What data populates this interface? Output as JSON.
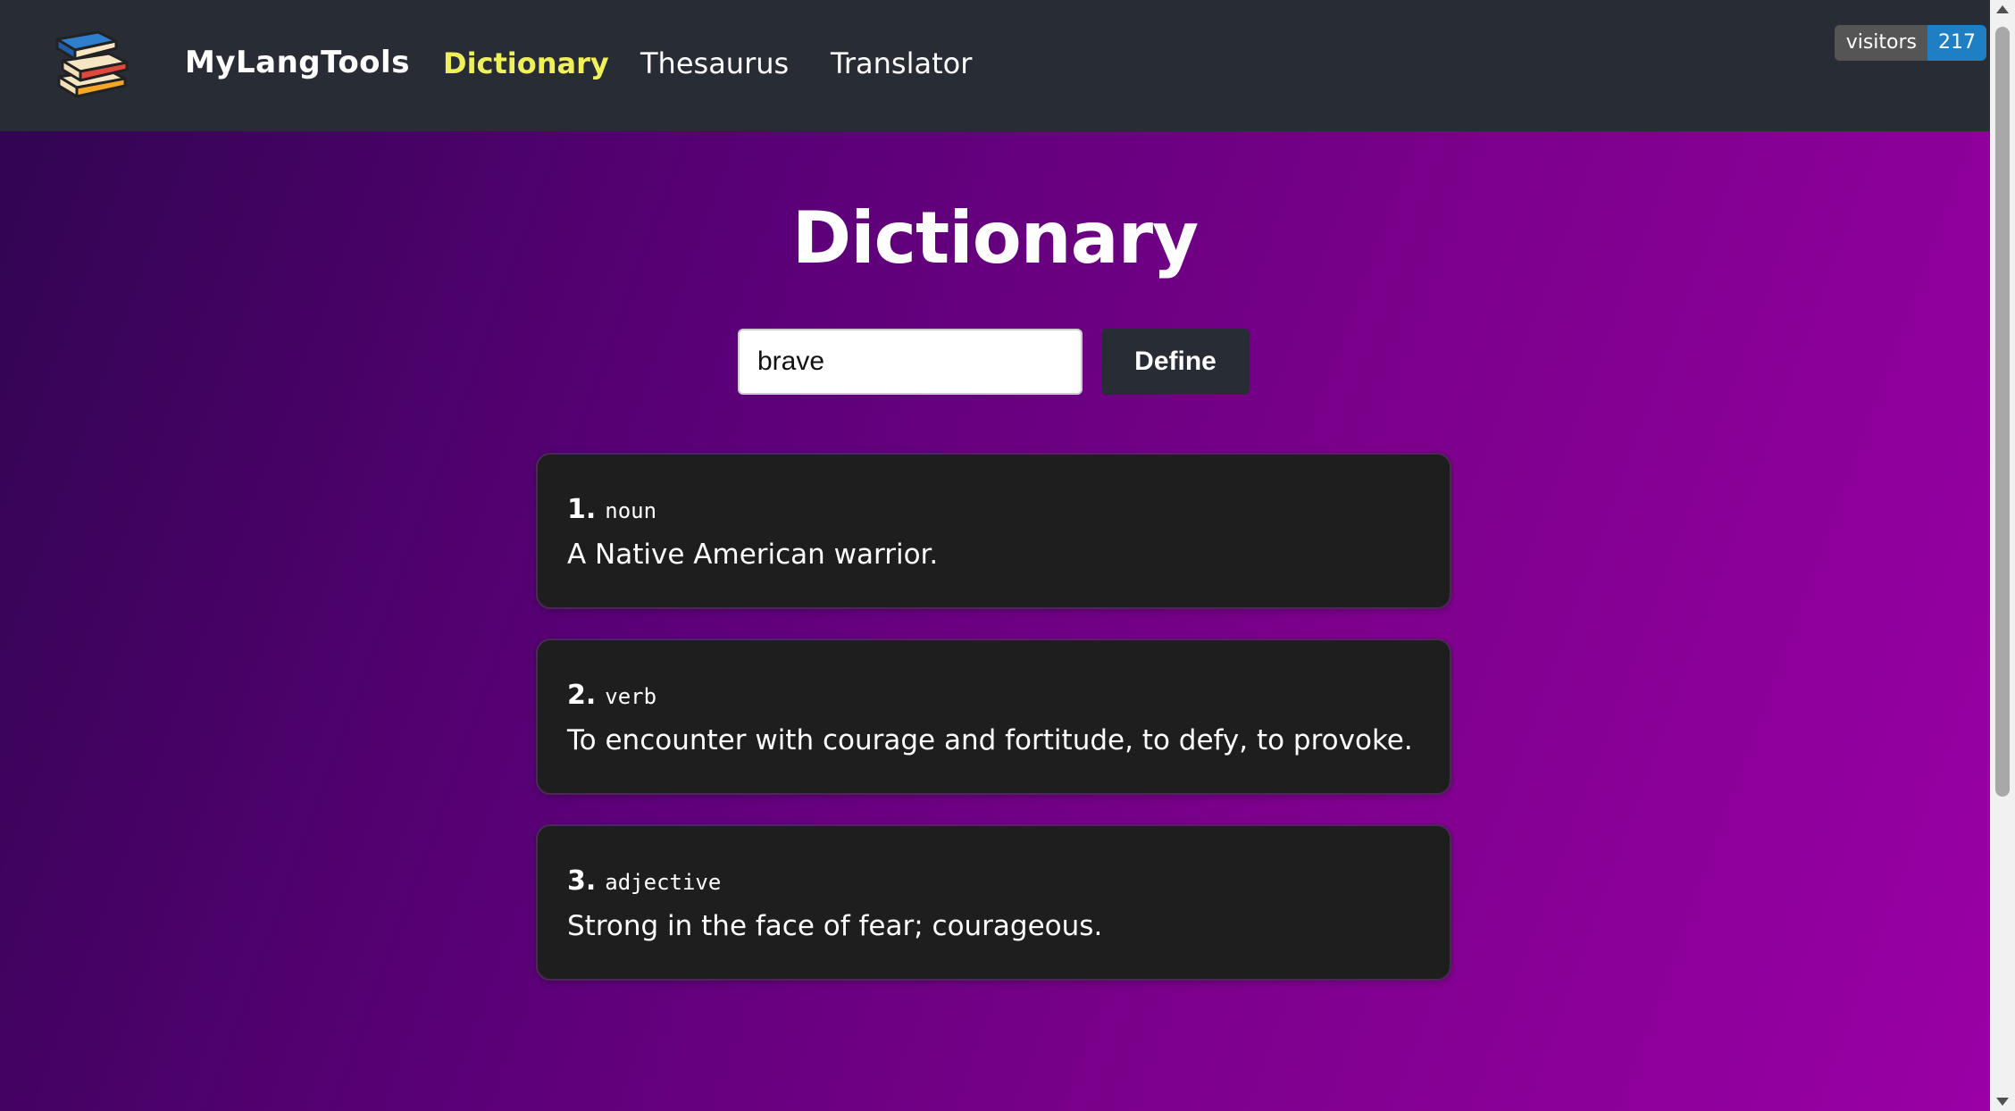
{
  "nav": {
    "brand": "MyLangTools",
    "links": [
      {
        "label": "Dictionary",
        "active": true
      },
      {
        "label": "Thesaurus",
        "active": false
      },
      {
        "label": "Translator",
        "active": false
      }
    ],
    "visitors_badge": {
      "label": "visitors",
      "count": "217"
    }
  },
  "main": {
    "title": "Dictionary",
    "search": {
      "value": "brave",
      "placeholder": ""
    },
    "define_label": "Define",
    "definitions": [
      {
        "number": "1.",
        "part_of_speech": "noun",
        "text": "A Native American warrior."
      },
      {
        "number": "2.",
        "part_of_speech": "verb",
        "text": "To encounter with courage and fortitude, to defy, to provoke."
      },
      {
        "number": "3.",
        "part_of_speech": "adjective",
        "text": "Strong in the face of fear; courageous."
      }
    ]
  },
  "colors": {
    "navbar_bg": "#282c34",
    "active_link": "#f0f05a",
    "card_bg": "#1e1e1e",
    "badge_count_bg": "#1e7fc4"
  },
  "icons": {
    "logo": "stack-of-books-icon"
  }
}
